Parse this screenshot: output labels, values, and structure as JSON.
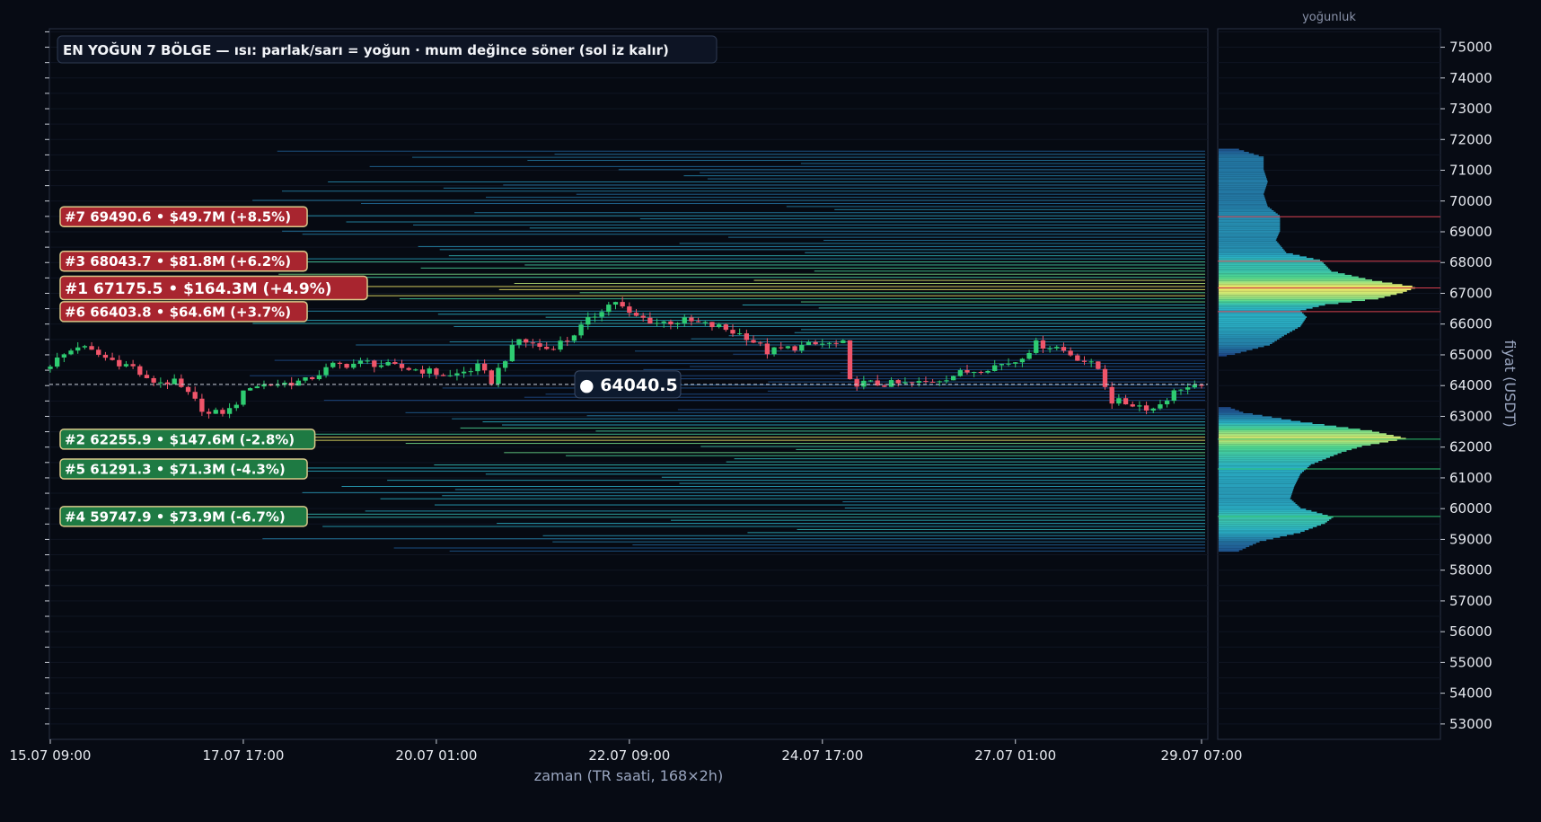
{
  "chart_data": {
    "type": "heatmap",
    "title": "EN YOĞUN 7 BÖLGE — ısı: parlak/sarı = yoğun · mum değince söner (sol iz kalır)",
    "xlabel": "zaman (TR saati, 168×2h)",
    "ylabel": "fiyat (USDT)",
    "side_panel_title": "yoğunluk",
    "ylim": [
      52500,
      75600
    ],
    "yticks": [
      53000,
      54000,
      55000,
      56000,
      57000,
      58000,
      59000,
      60000,
      61000,
      62000,
      63000,
      64000,
      65000,
      66000,
      67000,
      68000,
      69000,
      70000,
      71000,
      72000,
      73000,
      74000,
      75000
    ],
    "xtick_labels": [
      "15.07 09:00",
      "17.07 17:00",
      "20.07 01:00",
      "22.07 09:00",
      "24.07 17:00",
      "27.07 01:00",
      "29.07 07:00"
    ],
    "xticks_bar_index": [
      0,
      28,
      56,
      84,
      112,
      140,
      167
    ],
    "n_bars": 168,
    "current_price": 64040.5,
    "current_price_label": "● 64040.5",
    "zones": [
      {
        "rank": 7,
        "price": 69490.6,
        "volume": "$49.7M",
        "change": "+8.5%",
        "label": "#7  69490.6  •  $49.7M  (+8.5%)",
        "side": "resistance"
      },
      {
        "rank": 3,
        "price": 68043.7,
        "volume": "$81.8M",
        "change": "+6.2%",
        "label": "#3  68043.7  •  $81.8M  (+6.2%)",
        "side": "resistance"
      },
      {
        "rank": 1,
        "price": 67175.5,
        "volume": "$164.3M",
        "change": "+4.9%",
        "label": "#1  67175.5  •  $164.3M  (+4.9%)",
        "side": "resistance"
      },
      {
        "rank": 6,
        "price": 66403.8,
        "volume": "$64.6M",
        "change": "+3.7%",
        "label": "#6  66403.8  •  $64.6M  (+3.7%)",
        "side": "resistance"
      },
      {
        "rank": 2,
        "price": 62255.9,
        "volume": "$147.6M",
        "change": "-2.8%",
        "label": "#2  62255.9  •  $147.6M  (-2.8%)",
        "side": "support"
      },
      {
        "rank": 5,
        "price": 61291.3,
        "volume": "$71.3M",
        "change": "-4.3%",
        "label": "#5  61291.3  •  $71.3M  (-4.3%)",
        "side": "support"
      },
      {
        "rank": 4,
        "price": 59747.9,
        "volume": "$73.9M",
        "change": "-6.7%",
        "label": "#4  59747.9  •  $73.9M  (-6.7%)",
        "side": "support"
      }
    ],
    "price_path": [
      [
        0,
        64700
      ],
      [
        4,
        65300
      ],
      [
        8,
        64900
      ],
      [
        12,
        64600
      ],
      [
        14,
        64150
      ],
      [
        18,
        64100
      ],
      [
        20,
        63700
      ],
      [
        23,
        63050
      ],
      [
        26,
        63200
      ],
      [
        29,
        64000
      ],
      [
        33,
        64050
      ],
      [
        37,
        64150
      ],
      [
        41,
        64650
      ],
      [
        46,
        64750
      ],
      [
        50,
        64600
      ],
      [
        54,
        64500
      ],
      [
        58,
        64300
      ],
      [
        62,
        64600
      ],
      [
        64,
        64150
      ],
      [
        66,
        64900
      ],
      [
        68,
        65500
      ],
      [
        72,
        65200
      ],
      [
        75,
        65500
      ],
      [
        78,
        66100
      ],
      [
        80,
        66500
      ],
      [
        82,
        66750
      ],
      [
        84,
        66300
      ],
      [
        88,
        66050
      ],
      [
        92,
        66100
      ],
      [
        97,
        65900
      ],
      [
        101,
        65600
      ],
      [
        104,
        65100
      ],
      [
        108,
        65250
      ],
      [
        112,
        65350
      ],
      [
        115,
        65350
      ],
      [
        116,
        64100
      ],
      [
        120,
        64050
      ],
      [
        124,
        64050
      ],
      [
        127,
        64100
      ],
      [
        132,
        64400
      ],
      [
        136,
        64600
      ],
      [
        140,
        64800
      ],
      [
        143,
        65350
      ],
      [
        146,
        65250
      ],
      [
        150,
        64800
      ],
      [
        152,
        64550
      ],
      [
        154,
        63500
      ],
      [
        157,
        63400
      ],
      [
        160,
        63250
      ],
      [
        164,
        63950
      ],
      [
        167,
        63900
      ]
    ],
    "density_profile": [
      [
        58600,
        0.1
      ],
      [
        58900,
        0.2
      ],
      [
        59200,
        0.4
      ],
      [
        59500,
        0.52
      ],
      [
        59700,
        0.56
      ],
      [
        60000,
        0.4
      ],
      [
        60300,
        0.35
      ],
      [
        60700,
        0.37
      ],
      [
        61100,
        0.4
      ],
      [
        61400,
        0.45
      ],
      [
        61800,
        0.6
      ],
      [
        62000,
        0.7
      ],
      [
        62255.9,
        0.92
      ],
      [
        62500,
        0.75
      ],
      [
        62800,
        0.4
      ],
      [
        63100,
        0.12
      ],
      [
        63250,
        0.06
      ],
      [
        63300,
        0
      ],
      [
        64900,
        0
      ],
      [
        65000,
        0.08
      ],
      [
        65300,
        0.25
      ],
      [
        65600,
        0.32
      ],
      [
        65900,
        0.4
      ],
      [
        66200,
        0.43
      ],
      [
        66403.8,
        0.4
      ],
      [
        66600,
        0.52
      ],
      [
        66800,
        0.78
      ],
      [
        67000,
        0.9
      ],
      [
        67175.5,
        0.97
      ],
      [
        67400,
        0.75
      ],
      [
        67700,
        0.55
      ],
      [
        68043.7,
        0.5
      ],
      [
        68300,
        0.33
      ],
      [
        68700,
        0.28
      ],
      [
        69000,
        0.3
      ],
      [
        69490.6,
        0.3
      ],
      [
        69800,
        0.24
      ],
      [
        70200,
        0.22
      ],
      [
        70600,
        0.24
      ],
      [
        71000,
        0.22
      ],
      [
        71400,
        0.22
      ],
      [
        71650,
        0.1
      ],
      [
        71700,
        0
      ]
    ],
    "colors": {
      "background": "#070b14",
      "panel": "#060a12",
      "up_candle": "#2ecc71",
      "down_candle": "#f0556a",
      "resistance_label": "#a8252f",
      "support_label": "#1e7a43",
      "heat_low": "#1c3a80",
      "heat_mid": "#2ab0c4",
      "heat_high": "#f5ec6a"
    }
  }
}
